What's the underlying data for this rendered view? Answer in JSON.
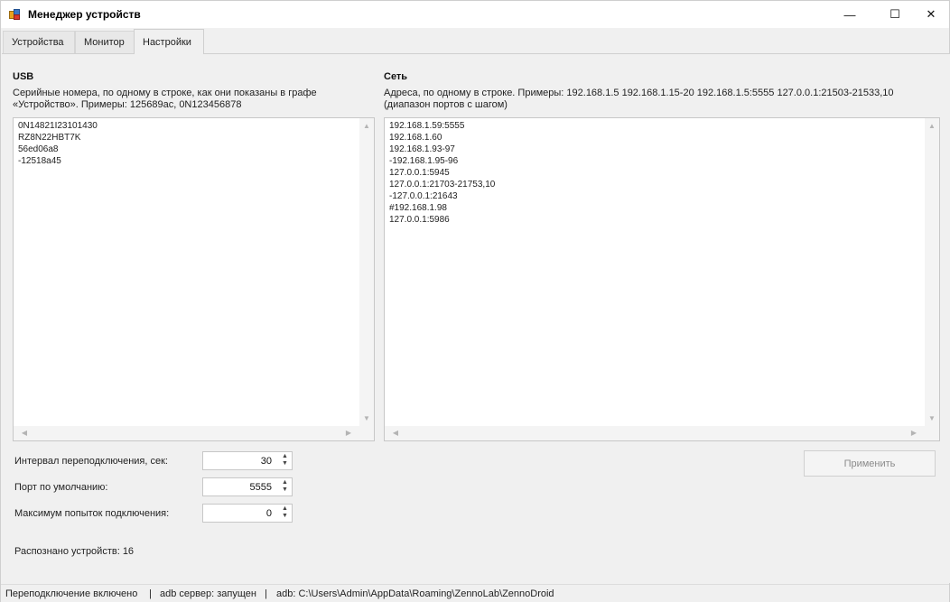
{
  "window": {
    "title": "Менеджер устройств",
    "controls": {
      "minimize": "—",
      "maximize": "☐",
      "close": "✕"
    }
  },
  "tabs": [
    {
      "label": "Устройства"
    },
    {
      "label": "Монитор"
    },
    {
      "label": "Настройки"
    }
  ],
  "usb": {
    "title": "USB",
    "description_line1": "Серийные номера, по одному в строке, как они показаны в графе",
    "description_line2": "«Устройство». Примеры: 125689ac, 0N123456878",
    "lines": [
      "0N14821I23101430",
      "RZ8N22HBT7K",
      "56ed06a8",
      "-12518a45"
    ]
  },
  "network": {
    "title": "Сеть",
    "description_line1": "Адреса, по одному в строке. Примеры: 192.168.1.5   192.168.1.15-20   192.168.1.5:5555   127.0.0.1:21503-21533,10",
    "description_line2": "(диапазон портов с шагом)",
    "lines": [
      "192.168.1.59:5555",
      "192.168.1.60",
      "192.168.1.93-97",
      "-192.168.1.95-96",
      "127.0.0.1:5945",
      "127.0.0.1:21703-21753,10",
      "-127.0.0.1:21643",
      "#192.168.1.98",
      "127.0.0.1:5986"
    ]
  },
  "settings": {
    "reconnect_interval_label": "Интервал переподключения, сек:",
    "reconnect_interval_value": "30",
    "default_port_label": "Порт по умолчанию:",
    "default_port_value": "5555",
    "max_attempts_label": "Максимум попыток подключения:",
    "max_attempts_value": "0",
    "apply_label": "Применить",
    "recognized_label": "Распознано устройств: 16"
  },
  "statusbar": {
    "reconnect": "Переподключение включено",
    "sep1": "|",
    "adb_server": "adb сервер: запущен",
    "sep2": "|",
    "adb_path": "adb: C:\\Users\\Admin\\AppData\\Roaming\\ZennoLab\\ZennoDroid"
  },
  "arrows": {
    "up": "▲",
    "down": "▼",
    "left": "◀",
    "right": "▶"
  }
}
